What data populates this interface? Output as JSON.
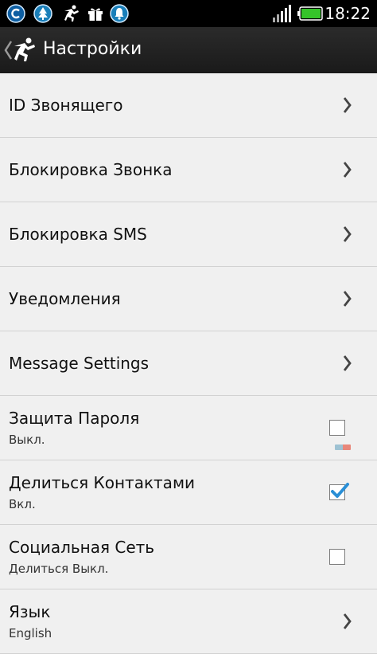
{
  "status_bar": {
    "time": "18:22",
    "icons": [
      "c-app-icon",
      "tree-icon",
      "runner-icon",
      "gift-icon",
      "bell-icon",
      "signal-icon",
      "battery-icon"
    ]
  },
  "action_bar": {
    "title": "Настройки",
    "back_icon": "chevron-left-icon",
    "logo_icon": "runner-icon"
  },
  "settings": [
    {
      "title": "ID Звонящего",
      "type": "nav"
    },
    {
      "title": "Блокировка Звонка",
      "type": "nav"
    },
    {
      "title": "Блокировка SMS",
      "type": "nav"
    },
    {
      "title": "Уведомления",
      "type": "nav"
    },
    {
      "title": "Message Settings",
      "type": "nav"
    },
    {
      "title": "Защита Пароля",
      "subtitle": "Выкл.",
      "type": "checkbox",
      "checked": false
    },
    {
      "title": "Делиться Контактами",
      "subtitle": "Вкл.",
      "type": "checkbox",
      "checked": true
    },
    {
      "title": "Социальная Сеть",
      "subtitle": "Делиться Выкл.",
      "type": "checkbox",
      "checked": false
    },
    {
      "title": "Язык",
      "subtitle": "English",
      "type": "nav"
    }
  ],
  "colors": {
    "status_bar_bg": "#000000",
    "action_bar_bg": "#1f1f1f",
    "list_bg": "#f0f0f0",
    "check_accent": "#2a8fd6",
    "battery_green": "#35c42a"
  }
}
